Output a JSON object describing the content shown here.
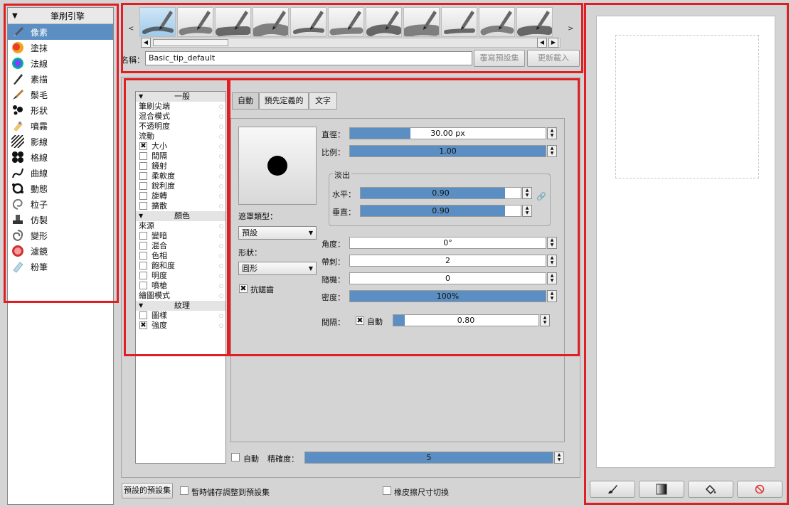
{
  "engines": {
    "header": "筆刷引擎",
    "items": [
      {
        "label": "像素",
        "icon": "pixel-brush-icon",
        "selected": true
      },
      {
        "label": "塗抹",
        "icon": "smudge-icon"
      },
      {
        "label": "法線",
        "icon": "normal-sphere-icon"
      },
      {
        "label": "素描",
        "icon": "sketch-pencil-icon"
      },
      {
        "label": "鬃毛",
        "icon": "bristle-brush-icon"
      },
      {
        "label": "形狀",
        "icon": "shape-dots-icon"
      },
      {
        "label": "噴霧",
        "icon": "spray-icon"
      },
      {
        "label": "影線",
        "icon": "hatching-icon"
      },
      {
        "label": "格線",
        "icon": "grid-dots-icon"
      },
      {
        "label": "曲線",
        "icon": "curve-icon"
      },
      {
        "label": "動態",
        "icon": "dynamic-icon"
      },
      {
        "label": "粒子",
        "icon": "particle-icon"
      },
      {
        "label": "仿製",
        "icon": "clone-stamp-icon"
      },
      {
        "label": "變形",
        "icon": "deform-icon"
      },
      {
        "label": "濾鏡",
        "icon": "filter-icon"
      },
      {
        "label": "粉筆",
        "icon": "chalk-icon"
      }
    ]
  },
  "presets": {
    "name_label": "名稱：",
    "name_value": "Basic_tip_default",
    "overwrite_label": "覆寫預設集",
    "reload_label": "更新載入",
    "left_arrow": "<",
    "right_arrow": ">"
  },
  "options": {
    "items": [
      {
        "label": "一般",
        "type": "header"
      },
      {
        "label": "筆刷尖端",
        "type": "plain"
      },
      {
        "label": "混合模式",
        "type": "plain"
      },
      {
        "label": "不透明度",
        "type": "plain"
      },
      {
        "label": "流動",
        "type": "plain"
      },
      {
        "label": "大小",
        "type": "check",
        "checked": true
      },
      {
        "label": "間隔",
        "type": "check",
        "checked": false
      },
      {
        "label": "鏡射",
        "type": "check",
        "checked": false
      },
      {
        "label": "柔軟度",
        "type": "check",
        "checked": false
      },
      {
        "label": "銳利度",
        "type": "check",
        "checked": false
      },
      {
        "label": "旋轉",
        "type": "check",
        "checked": false
      },
      {
        "label": "擴散",
        "type": "check",
        "checked": false
      },
      {
        "label": "顏色",
        "type": "header"
      },
      {
        "label": "來源",
        "type": "plain"
      },
      {
        "label": "變暗",
        "type": "check",
        "checked": false
      },
      {
        "label": "混合",
        "type": "check",
        "checked": false
      },
      {
        "label": "色相",
        "type": "check",
        "checked": false
      },
      {
        "label": "飽和度",
        "type": "check",
        "checked": false
      },
      {
        "label": "明度",
        "type": "check",
        "checked": false
      },
      {
        "label": "噴槍",
        "type": "check",
        "checked": false
      },
      {
        "label": "繪圖模式",
        "type": "plain"
      },
      {
        "label": "紋理",
        "type": "header"
      },
      {
        "label": "圖樣",
        "type": "check",
        "checked": false
      },
      {
        "label": "強度",
        "type": "check",
        "checked": true
      }
    ]
  },
  "tabs": [
    {
      "label": "自動",
      "active": true
    },
    {
      "label": "預先定義的",
      "active": false
    },
    {
      "label": "文字",
      "active": false
    }
  ],
  "tip": {
    "mask_type_label": "遮罩類型：",
    "mask_type_value": "預設",
    "shape_label": "形狀：",
    "shape_value": "圓形",
    "antialias_label": "抗鋸齒",
    "antialias_checked": true,
    "diameter_label": "直徑：",
    "diameter_value": "30.00 px",
    "diameter_fill": 0.31,
    "ratio_label": "比例：",
    "ratio_value": "1.00",
    "ratio_fill": 1.0,
    "fade_label": "淡出",
    "horizontal_label": "水平：",
    "horizontal_value": "0.90",
    "horizontal_fill": 0.9,
    "vertical_label": "垂直：",
    "vertical_value": "0.90",
    "vertical_fill": 0.9,
    "angle_label": "角度：",
    "angle_value": "0°",
    "angle_fill": 0,
    "spikes_label": "帶刺：",
    "spikes_value": "2",
    "spikes_fill": 0,
    "random_label": "隨機：",
    "random_value": "0",
    "random_fill": 0,
    "density_label": "密度：",
    "density_value": "100%",
    "density_fill": 1.0,
    "spacing_label": "間隔：",
    "spacing_auto_label": "自動",
    "spacing_auto_checked": true,
    "spacing_value": "0.80",
    "spacing_fill": 0.08,
    "precision_auto_label": "自動",
    "precision_label": "精確度：",
    "precision_value": "5",
    "precision_fill": 1.0
  },
  "bottom": {
    "preset_button": "預設的預設集",
    "temp_save_label": "暫時儲存調整到預設集",
    "eraser_toggle_label": "橡皮擦尺寸切換"
  },
  "tools": [
    {
      "icon": "brush-icon"
    },
    {
      "icon": "gradient-icon"
    },
    {
      "icon": "paint-bucket-icon"
    },
    {
      "icon": "clear-icon"
    }
  ],
  "colors": {
    "highlight": "#5b8ec2",
    "annotation_red": "#e01e24"
  }
}
